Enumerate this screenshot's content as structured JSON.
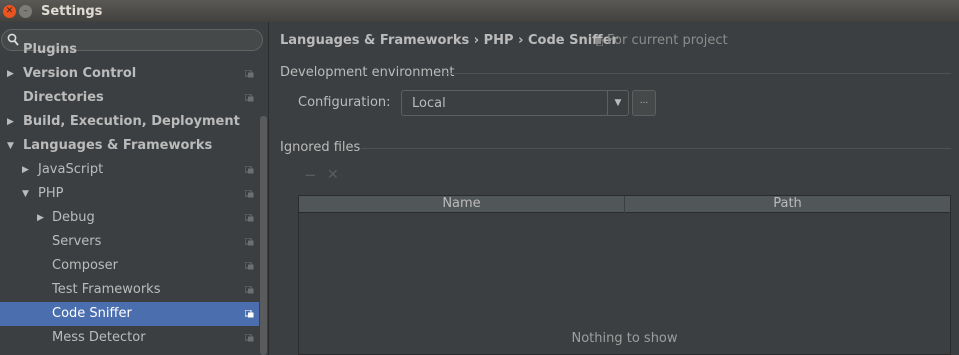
{
  "window": {
    "title": "Settings"
  },
  "search": {
    "placeholder": ""
  },
  "sidebar": {
    "items": [
      {
        "label": "Plugins",
        "level": 0,
        "arrow": "",
        "bold": true,
        "project_icon": false,
        "selected": false
      },
      {
        "label": "Version Control",
        "level": 0,
        "arrow": "▶",
        "bold": true,
        "project_icon": true,
        "selected": false
      },
      {
        "label": "Directories",
        "level": 0,
        "arrow": "",
        "bold": true,
        "project_icon": true,
        "selected": false
      },
      {
        "label": "Build, Execution, Deployment",
        "level": 0,
        "arrow": "▶",
        "bold": true,
        "project_icon": false,
        "selected": false
      },
      {
        "label": "Languages & Frameworks",
        "level": 0,
        "arrow": "▼",
        "bold": true,
        "project_icon": false,
        "selected": false
      },
      {
        "label": "JavaScript",
        "level": 1,
        "arrow": "▶",
        "bold": false,
        "project_icon": true,
        "selected": false
      },
      {
        "label": "PHP",
        "level": 1,
        "arrow": "▼",
        "bold": false,
        "project_icon": true,
        "selected": false
      },
      {
        "label": "Debug",
        "level": 2,
        "arrow": "▶",
        "bold": false,
        "project_icon": true,
        "selected": false
      },
      {
        "label": "Servers",
        "level": 2,
        "arrow": "",
        "bold": false,
        "project_icon": true,
        "selected": false
      },
      {
        "label": "Composer",
        "level": 2,
        "arrow": "",
        "bold": false,
        "project_icon": true,
        "selected": false
      },
      {
        "label": "Test Frameworks",
        "level": 2,
        "arrow": "",
        "bold": false,
        "project_icon": true,
        "selected": false
      },
      {
        "label": "Code Sniffer",
        "level": 2,
        "arrow": "",
        "bold": false,
        "project_icon": true,
        "selected": true
      },
      {
        "label": "Mess Detector",
        "level": 2,
        "arrow": "",
        "bold": false,
        "project_icon": true,
        "selected": false
      }
    ]
  },
  "main": {
    "breadcrumb": "Languages & Frameworks › PHP › Code Sniffer",
    "scope_label": "For current project",
    "dev_env_section": "Development environment",
    "configuration_label": "Configuration:",
    "configuration_value": "Local",
    "more_button": "...",
    "ignored_section": "Ignored files",
    "table": {
      "columns": [
        "Name",
        "Path"
      ],
      "empty_text": "Nothing to show"
    }
  },
  "colors": {
    "background": "#3c3f41",
    "selection": "#4b6eaf",
    "close_button": "#e95420"
  }
}
